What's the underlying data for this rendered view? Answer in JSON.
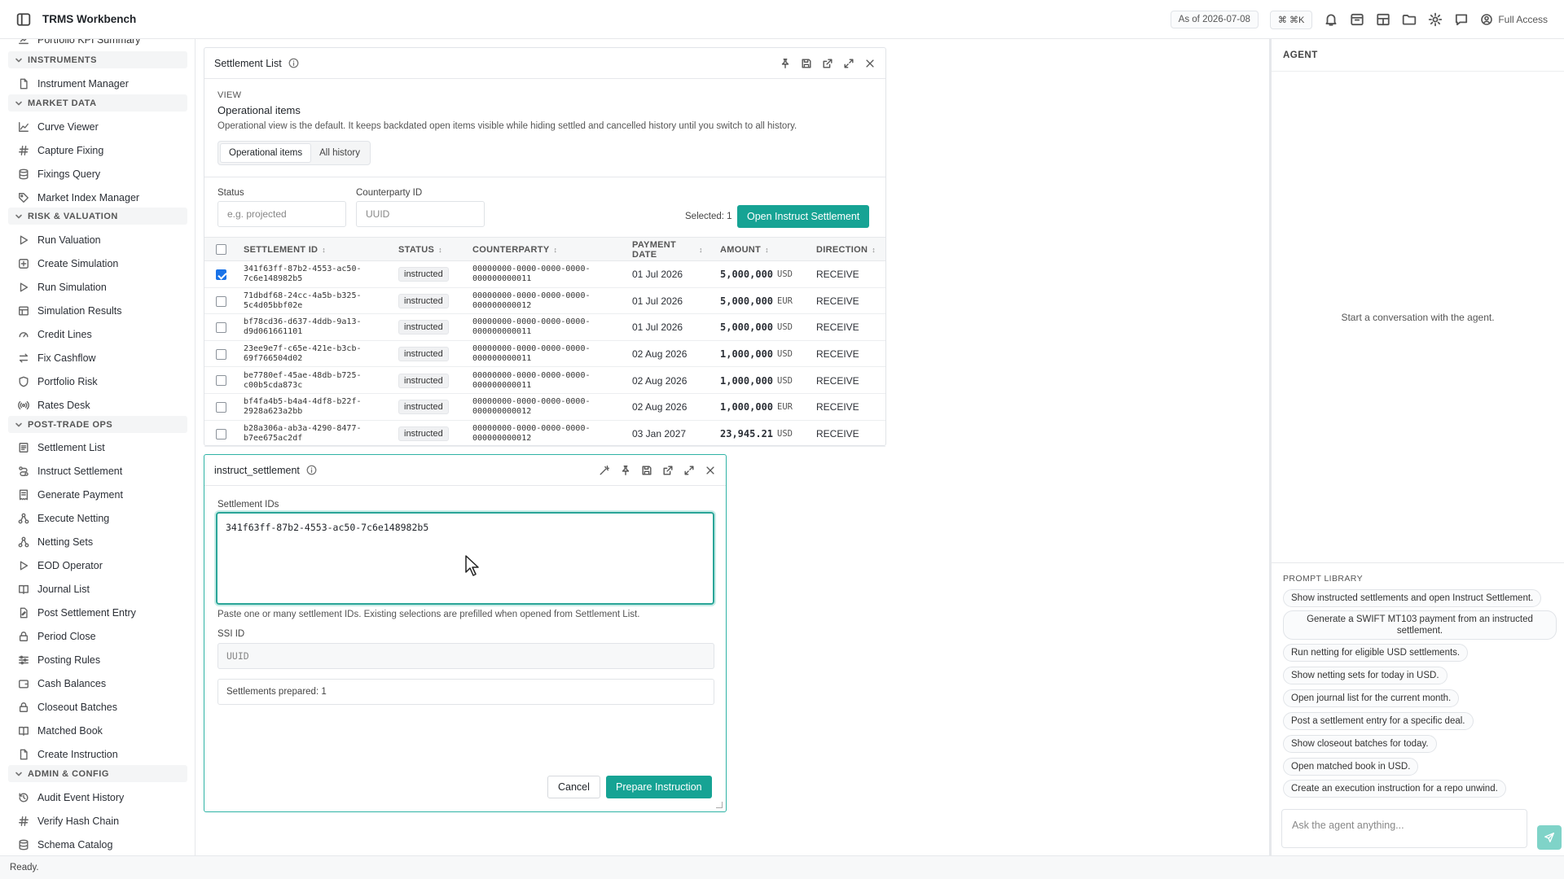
{
  "topbar": {
    "title": "TRMS Workbench",
    "as_of": "As of 2026-07-08",
    "shortcut": "⌘ ⌘K",
    "access": "Full Access"
  },
  "sidebar": {
    "cut_item": "Portfolio KPI Summary",
    "sections": [
      {
        "label": "INSTRUMENTS",
        "items": [
          "Instrument Manager"
        ]
      },
      {
        "label": "MARKET DATA",
        "items": [
          "Curve Viewer",
          "Capture Fixing",
          "Fixings Query",
          "Market Index Manager"
        ]
      },
      {
        "label": "RISK & VALUATION",
        "items": [
          "Run Valuation",
          "Create Simulation",
          "Run Simulation",
          "Simulation Results",
          "Credit Lines",
          "Fix Cashflow",
          "Portfolio Risk",
          "Rates Desk"
        ]
      },
      {
        "label": "POST-TRADE OPS",
        "items": [
          "Settlement List",
          "Instruct Settlement",
          "Generate Payment",
          "Execute Netting",
          "Netting Sets",
          "EOD Operator",
          "Journal List",
          "Post Settlement Entry",
          "Period Close",
          "Posting Rules",
          "Cash Balances",
          "Closeout Batches",
          "Matched Book",
          "Create Instruction"
        ]
      },
      {
        "label": "ADMIN & CONFIG",
        "items": [
          "Audit Event History",
          "Verify Hash Chain",
          "Schema Catalog"
        ]
      }
    ]
  },
  "settlement_list": {
    "title": "Settlement List",
    "view_label": "VIEW",
    "view_name": "Operational items",
    "view_desc": "Operational view is the default. It keeps backdated open items visible while hiding settled and cancelled history until you switch to all history.",
    "seg_operational": "Operational items",
    "seg_all": "All history",
    "status_label": "Status",
    "status_placeholder": "e.g. projected",
    "cp_label": "Counterparty ID",
    "cp_placeholder": "UUID",
    "selected": "Selected: 1",
    "open_button": "Open Instruct Settlement",
    "columns": {
      "id": "SETTLEMENT ID",
      "status": "STATUS",
      "counterparty": "COUNTERPARTY",
      "payment_date_1": "PAYMENT",
      "payment_date_2": "DATE",
      "amount": "AMOUNT",
      "direction": "DIRECTION",
      "sort": "↕"
    },
    "rows": [
      {
        "id1": "341f63ff-87b2-4553-ac50-",
        "id2": "7c6e148982b5",
        "status": "instructed",
        "cp1": "00000000-0000-0000-0000-",
        "cp2": "000000000011",
        "date": "01 Jul 2026",
        "amount": "5,000,000",
        "ccy": "USD",
        "dir": "RECEIVE",
        "checked": true
      },
      {
        "id1": "71dbdf68-24cc-4a5b-b325-",
        "id2": "5c4d05bbf02e",
        "status": "instructed",
        "cp1": "00000000-0000-0000-0000-",
        "cp2": "000000000012",
        "date": "01 Jul 2026",
        "amount": "5,000,000",
        "ccy": "EUR",
        "dir": "RECEIVE",
        "checked": false
      },
      {
        "id1": "bf78cd36-d637-4ddb-9a13-",
        "id2": "d9d061661101",
        "status": "instructed",
        "cp1": "00000000-0000-0000-0000-",
        "cp2": "000000000011",
        "date": "01 Jul 2026",
        "amount": "5,000,000",
        "ccy": "USD",
        "dir": "RECEIVE",
        "checked": false
      },
      {
        "id1": "23ee9e7f-c65e-421e-b3cb-",
        "id2": "69f766504d02",
        "status": "instructed",
        "cp1": "00000000-0000-0000-0000-",
        "cp2": "000000000011",
        "date": "02 Aug 2026",
        "amount": "1,000,000",
        "ccy": "USD",
        "dir": "RECEIVE",
        "checked": false
      },
      {
        "id1": "be7780ef-45ae-48db-b725-",
        "id2": "c00b5cda873c",
        "status": "instructed",
        "cp1": "00000000-0000-0000-0000-",
        "cp2": "000000000011",
        "date": "02 Aug 2026",
        "amount": "1,000,000",
        "ccy": "USD",
        "dir": "RECEIVE",
        "checked": false
      },
      {
        "id1": "bf4fa4b5-b4a4-4df8-b22f-",
        "id2": "2928a623a2bb",
        "status": "instructed",
        "cp1": "00000000-0000-0000-0000-",
        "cp2": "000000000012",
        "date": "02 Aug 2026",
        "amount": "1,000,000",
        "ccy": "EUR",
        "dir": "RECEIVE",
        "checked": false
      },
      {
        "id1": "b28a306a-ab3a-4290-8477-",
        "id2": "b7ee675ac2df",
        "status": "instructed",
        "cp1": "00000000-0000-0000-0000-",
        "cp2": "000000000012",
        "date": "03 Jan 2027",
        "amount": "23,945.21",
        "ccy": "USD",
        "dir": "RECEIVE",
        "checked": false
      }
    ]
  },
  "instruct": {
    "title": "instruct_settlement",
    "ids_label": "Settlement IDs",
    "ids_value": "341f63ff-87b2-4553-ac50-7c6e148982b5",
    "help": "Paste one or many settlement IDs. Existing selections are prefilled when opened from Settlement List.",
    "ssi_label": "SSI ID",
    "ssi_placeholder": "UUID",
    "prepared": "Settlements prepared: 1",
    "cancel": "Cancel",
    "prepare": "Prepare Instruction"
  },
  "agent": {
    "title": "AGENT",
    "empty": "Start a conversation with the agent.",
    "library_label": "PROMPT LIBRARY",
    "prompts": [
      "Show instructed settlements and open Instruct Settlement.",
      "Generate a SWIFT MT103 payment from an instructed settlement.",
      "Run netting for eligible USD settlements.",
      "Show netting sets for today in USD.",
      "Open journal list for the current month.",
      "Post a settlement entry for a specific deal.",
      "Show closeout batches for today.",
      "Open matched book in USD.",
      "Create an execution instruction for a repo unwind."
    ],
    "ask_placeholder": "Ask the agent anything..."
  },
  "status": "Ready."
}
